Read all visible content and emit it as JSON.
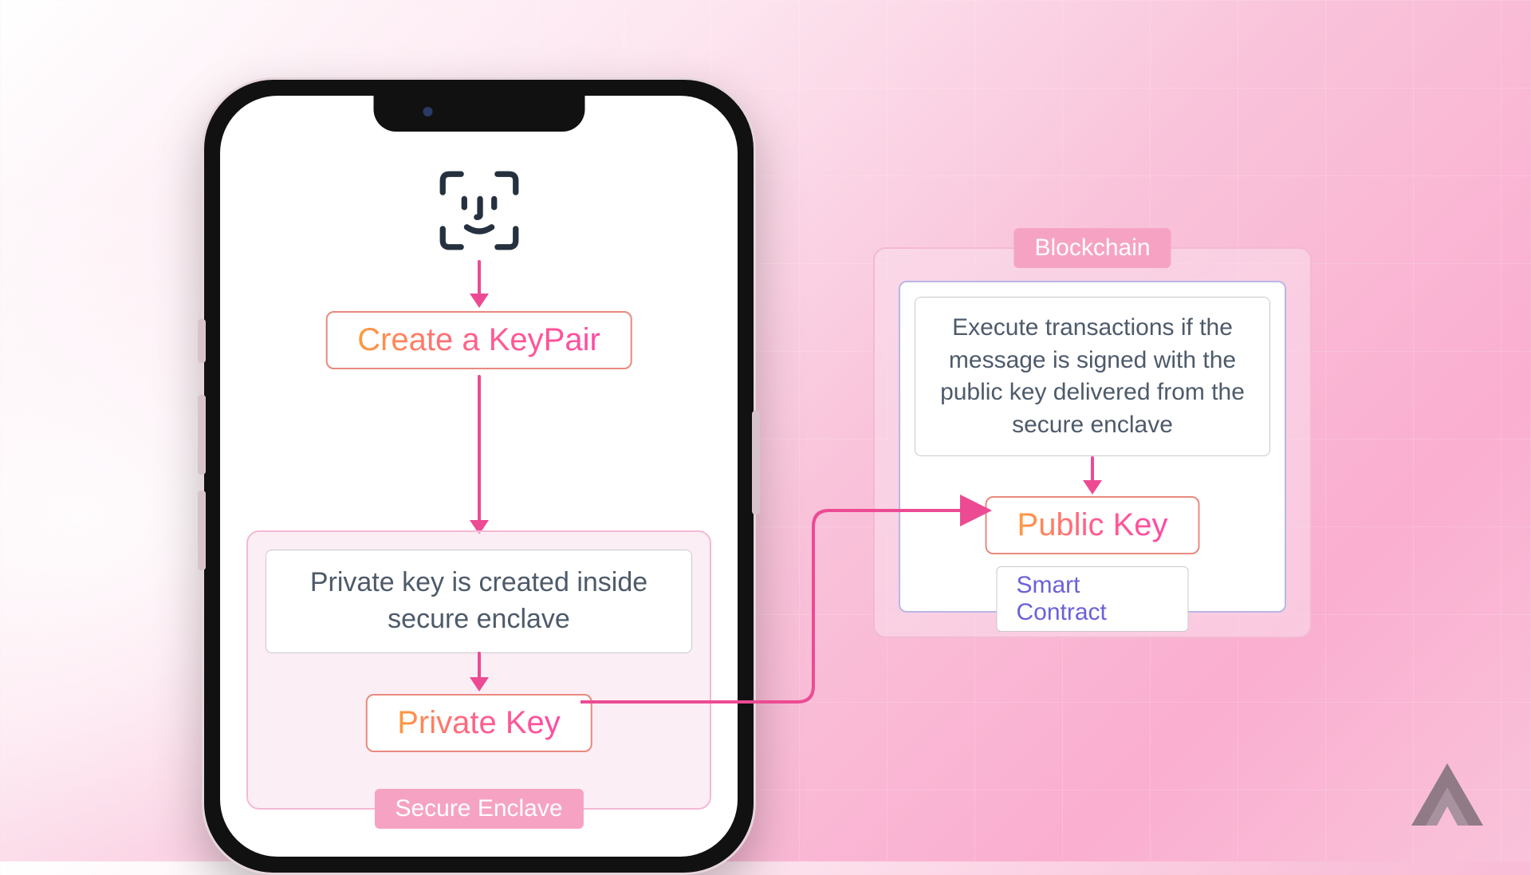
{
  "phone": {
    "create_keypair_label": "Create a KeyPair",
    "enclave_description": "Private key is created inside secure enclave",
    "private_key_label": "Private Key",
    "enclave_pill": "Secure Enclave"
  },
  "blockchain": {
    "pill": "Blockchain",
    "execute_text": "Execute transactions if the message is signed with the public key delivered from the secure enclave",
    "public_key_label": "Public Key",
    "contract_label": "Smart Contract"
  },
  "colors": {
    "arrow": "#ec4b93",
    "pill_bg": "#f6a3c3"
  }
}
